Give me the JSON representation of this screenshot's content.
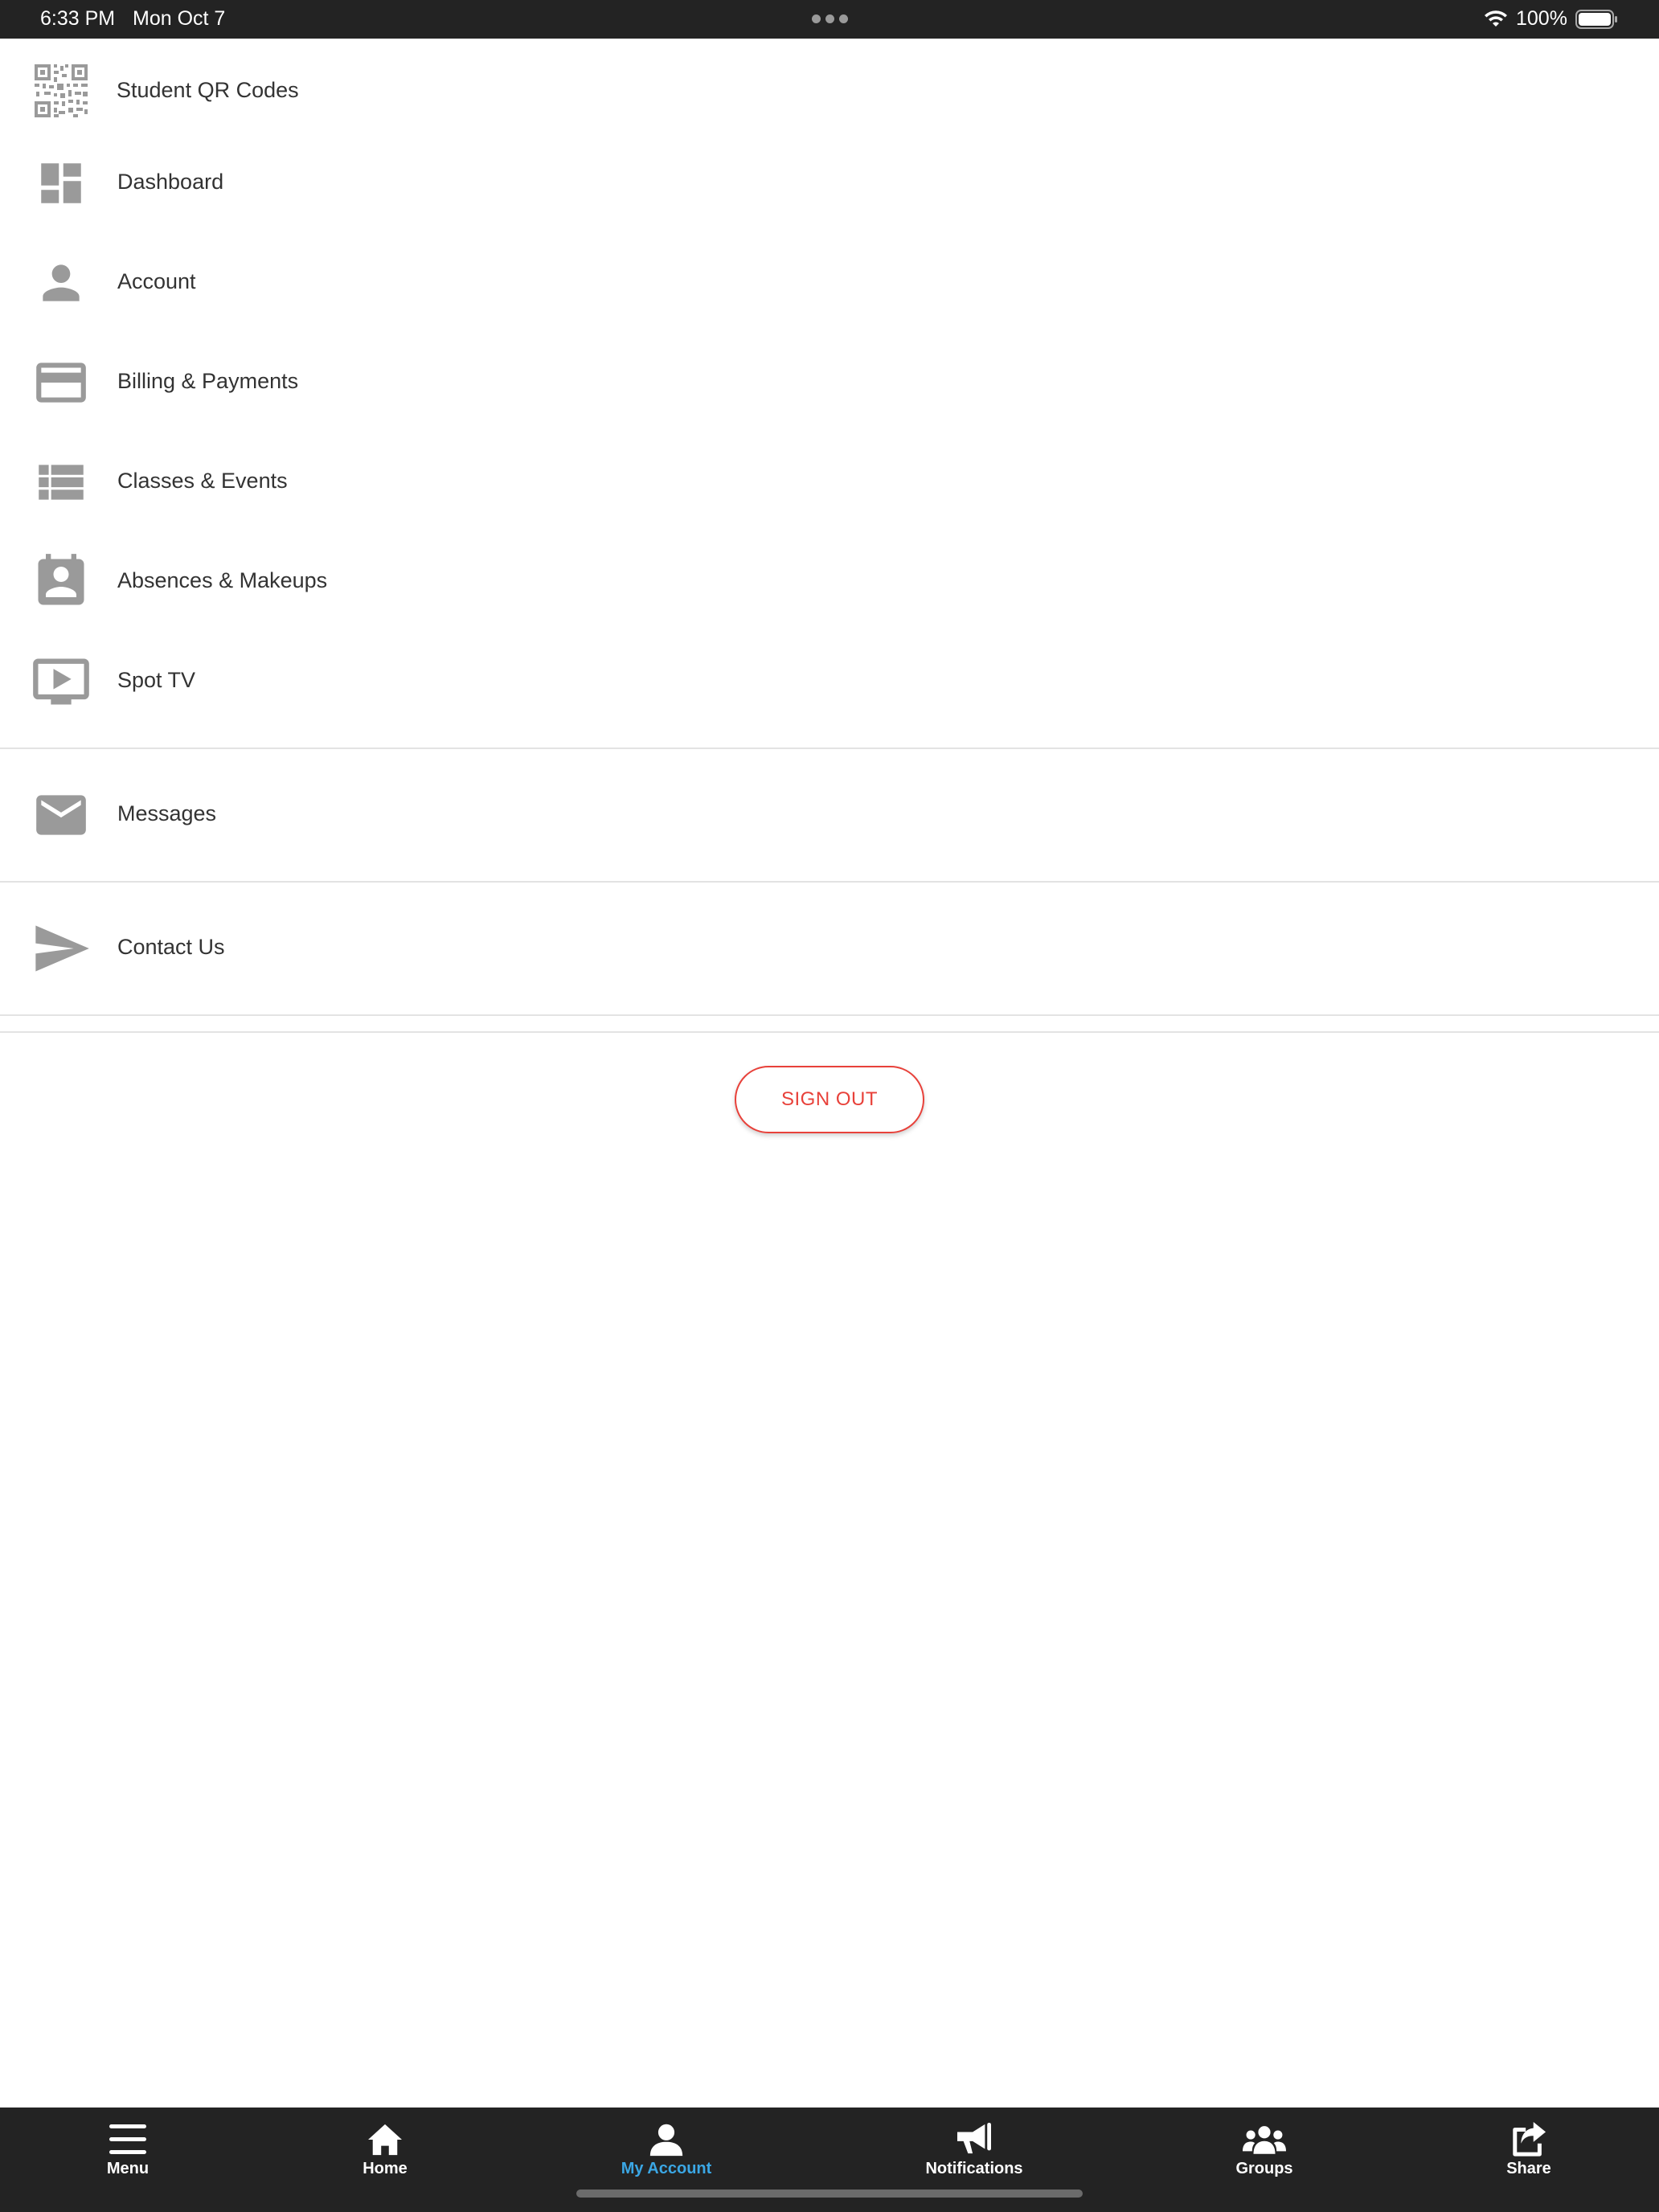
{
  "status_bar": {
    "time": "6:33 PM",
    "date": "Mon Oct 7",
    "battery": "100%"
  },
  "menu": {
    "items": [
      {
        "label": "Student QR Codes",
        "icon": "qr-code-icon"
      },
      {
        "label": "Dashboard",
        "icon": "dashboard-icon"
      },
      {
        "label": "Account",
        "icon": "person-icon"
      },
      {
        "label": "Billing & Payments",
        "icon": "credit-card-icon"
      },
      {
        "label": "Classes & Events",
        "icon": "list-icon"
      },
      {
        "label": "Absences & Makeups",
        "icon": "contact-calendar-icon"
      },
      {
        "label": "Spot TV",
        "icon": "tv-play-icon"
      },
      {
        "label": "Messages",
        "icon": "envelope-icon"
      },
      {
        "label": "Contact Us",
        "icon": "send-icon"
      }
    ],
    "icon_color": "#999999"
  },
  "sign_out": {
    "label": "SIGN OUT",
    "color": "#e8413a"
  },
  "tab_bar": {
    "tabs": [
      {
        "label": "Menu",
        "icon": "hamburger-icon"
      },
      {
        "label": "Home",
        "icon": "home-icon"
      },
      {
        "label": "My Account",
        "icon": "person-icon",
        "active": true
      },
      {
        "label": "Notifications",
        "icon": "megaphone-icon"
      },
      {
        "label": "Groups",
        "icon": "group-icon"
      },
      {
        "label": "Share",
        "icon": "share-icon"
      }
    ],
    "active_color": "#3ba7e5"
  }
}
